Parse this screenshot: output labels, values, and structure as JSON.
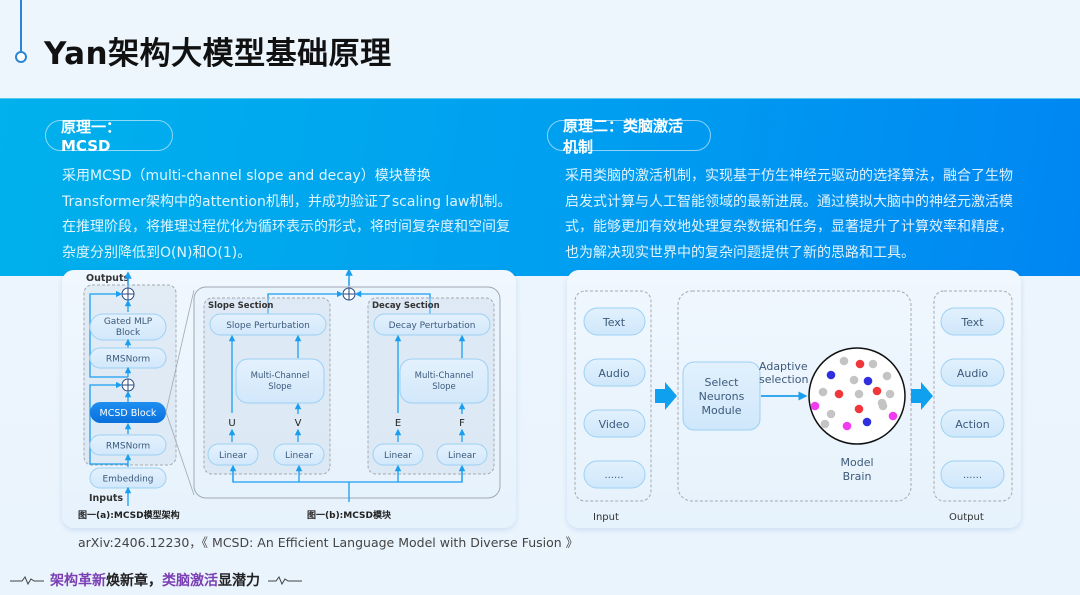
{
  "header": {
    "title": "Yan架构大模型基础原理"
  },
  "sections": [
    {
      "pill_label": "原理一：MCSD",
      "paragraph": "采用MCSD（multi-channel slope and decay）模块替换Transformer架构中的attention机制，并成功验证了scaling law机制。在推理阶段，将推理过程优化为循环表示的形式，将时间复杂度和空间复杂度分别降低到O(N)和O(1)。"
    },
    {
      "pill_label": "原理二：类脑激活机制",
      "paragraph": "采用类脑的激活机制，实现基于仿生神经元驱动的选择算法，融合了生物启发式计算与人工智能领域的最新进展。通过模拟大脑中的神经元激活模式，能够更加有效地处理复杂数据和任务，显著提升了计算效率和精度，也为解决现实世界中的复杂问题提供了新的思路和工具。"
    }
  ],
  "figure_a": {
    "outputs_label": "Outputs",
    "inputs_label": "Inputs",
    "blocks": [
      "Gated MLP",
      "Block",
      "RMSNorm",
      "MCSD Block",
      "RMSNorm",
      "Embedding"
    ],
    "caption": "图一(a):MCSD模型架构"
  },
  "figure_b": {
    "slope_section_label": "Slope Section",
    "decay_section_label": "Decay Section",
    "slope_perturbation": "Slope Perturbation",
    "decay_perturbation": "Decay Perturbation",
    "multi_channel_1": "Multi-Channel",
    "multi_channel_2": "Slope",
    "linear": "Linear",
    "vars": [
      "U",
      "V",
      "E",
      "F"
    ],
    "caption": "图一(b):MCSD模块"
  },
  "citation": "arXiv:2406.12230，《 MCSD: An Efficient Language Model with Diverse Fusion 》",
  "figure_2": {
    "input_label": "Input",
    "output_label": "Output",
    "inputs": [
      "Text",
      "Audio",
      "Video",
      "......"
    ],
    "outputs": [
      "Text",
      "Audio",
      "Action",
      "......"
    ],
    "select_module": [
      "Select",
      "Neurons",
      "Module"
    ],
    "adaptive": [
      "Adaptive",
      "selection"
    ],
    "brain_label": [
      "Model",
      "Brain"
    ],
    "neuron_colors": {
      "inactive": "#c4c4c4",
      "red": "#f0383c",
      "blue": "#2f2fe0",
      "magenta": "#f23bf0"
    }
  },
  "footer": {
    "part1_purple": "架构革新",
    "part1_black": "焕新章，",
    "part2_purple": "类脑激活",
    "part2_black": "显潜力"
  }
}
